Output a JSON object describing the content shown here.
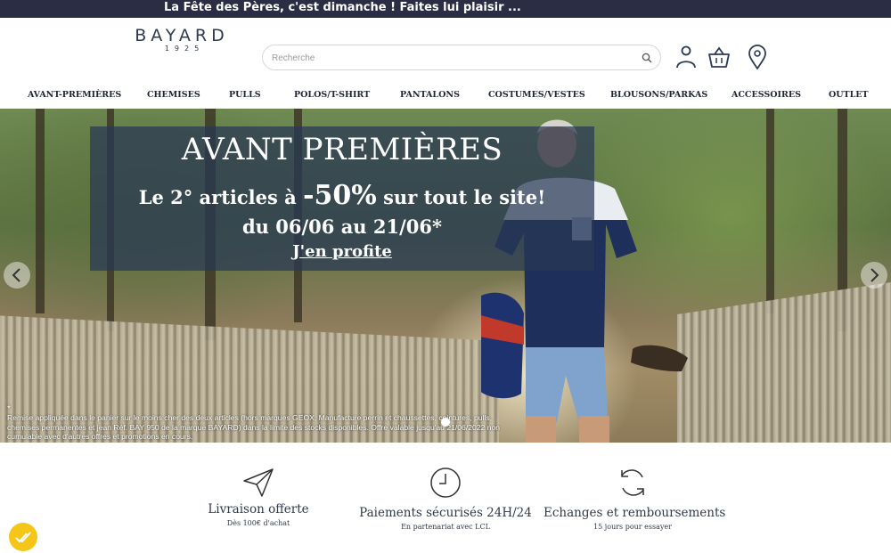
{
  "announcement": {
    "text": "La Fête des Pères, c'est dimanche ! Faites lui plaisir ..."
  },
  "brand": {
    "name": "BAYARD",
    "year": "1925"
  },
  "search": {
    "placeholder": "Recherche"
  },
  "header_icons": {
    "account": "user-icon",
    "cart": "basket-icon",
    "stores": "location-pin-icon"
  },
  "nav": {
    "items": [
      {
        "label": "AVANT-PREMIÈRES"
      },
      {
        "label": "CHEMISES"
      },
      {
        "label": "PULLS"
      },
      {
        "label": "POLOS/T-SHIRT"
      },
      {
        "label": "PANTALONS"
      },
      {
        "label": "COSTUMES/VESTES"
      },
      {
        "label": "BLOUSONS/PARKAS"
      },
      {
        "label": "ACCESSOIRES"
      },
      {
        "label": "OUTLET"
      }
    ]
  },
  "hero": {
    "title": "AVANT PREMIÈRES",
    "line2_prefix": "Le 2° articles à ",
    "line2_discount": "-50%",
    "line2_suffix": " sur tout le site!",
    "dates": "du 06/06 au 21/06*",
    "cta": "J'en profite",
    "disclaimer_star": "*",
    "disclaimer": "Remise appliquée dans le panier sur le moins cher des deux articles (hors marques GEOX, Manufacture perrin et chaussettes, ceintures, pulls, chemises permanentes et jean Réf. BAY 950 de la marque BAYARD) dans la limite des stocks disponibles. Offre valable jusqu'au 21/06/2022 non cumulable avec d'autres offres et promotions en cours."
  },
  "features": [
    {
      "icon": "paper-plane-icon",
      "title": "Livraison offerte",
      "subtitle": "Dès 100€ d'achat"
    },
    {
      "icon": "clock-icon",
      "title": "Paiements sécurisés 24H/24",
      "subtitle": "En partenariat avec LCL"
    },
    {
      "icon": "refresh-icon",
      "title": "Echanges et remboursements",
      "subtitle": "15 jours pour essayer"
    }
  ],
  "colors": {
    "topbar": "#2b2d44",
    "text_dark": "#1f2533",
    "cookie_badge": "#f5c518"
  }
}
